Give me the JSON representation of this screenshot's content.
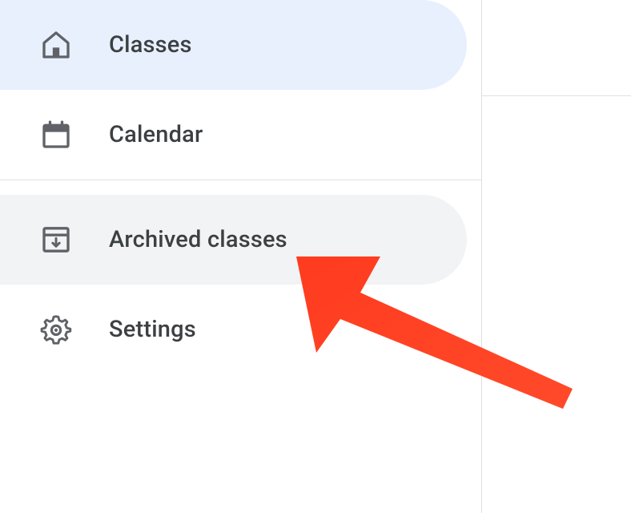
{
  "sidebar": {
    "items": [
      {
        "label": "Classes",
        "icon": "home-icon",
        "selected": true
      },
      {
        "label": "Calendar",
        "icon": "calendar-icon",
        "selected": false
      },
      {
        "label": "Archived classes",
        "icon": "archive-icon",
        "selected": false,
        "hovered": true
      },
      {
        "label": "Settings",
        "icon": "gear-icon",
        "selected": false
      }
    ]
  },
  "annotation": {
    "arrow_color": "#ff3b1f",
    "target": "archived-classes"
  }
}
